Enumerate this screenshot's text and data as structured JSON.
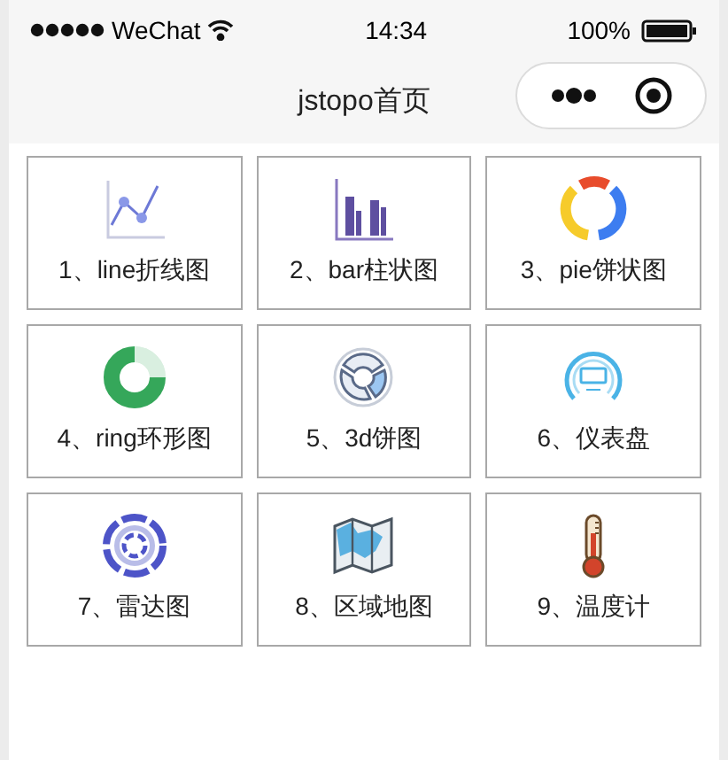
{
  "status_bar": {
    "carrier": "WeChat",
    "time": "14:34",
    "battery": "100%"
  },
  "nav_bar": {
    "title": "jstopo首页"
  },
  "items": [
    {
      "kind": "line",
      "label": "1、line折线图"
    },
    {
      "kind": "bar",
      "label": "2、bar柱状图"
    },
    {
      "kind": "pie",
      "label": "3、pie饼状图"
    },
    {
      "kind": "ring",
      "label": "4、ring环形图"
    },
    {
      "kind": "pie3d",
      "label": "5、3d饼图"
    },
    {
      "kind": "gauge",
      "label": "6、仪表盘"
    },
    {
      "kind": "radar",
      "label": "7、雷达图"
    },
    {
      "kind": "map",
      "label": "8、区域地图"
    },
    {
      "kind": "thermometer",
      "label": "9、温度计"
    }
  ]
}
